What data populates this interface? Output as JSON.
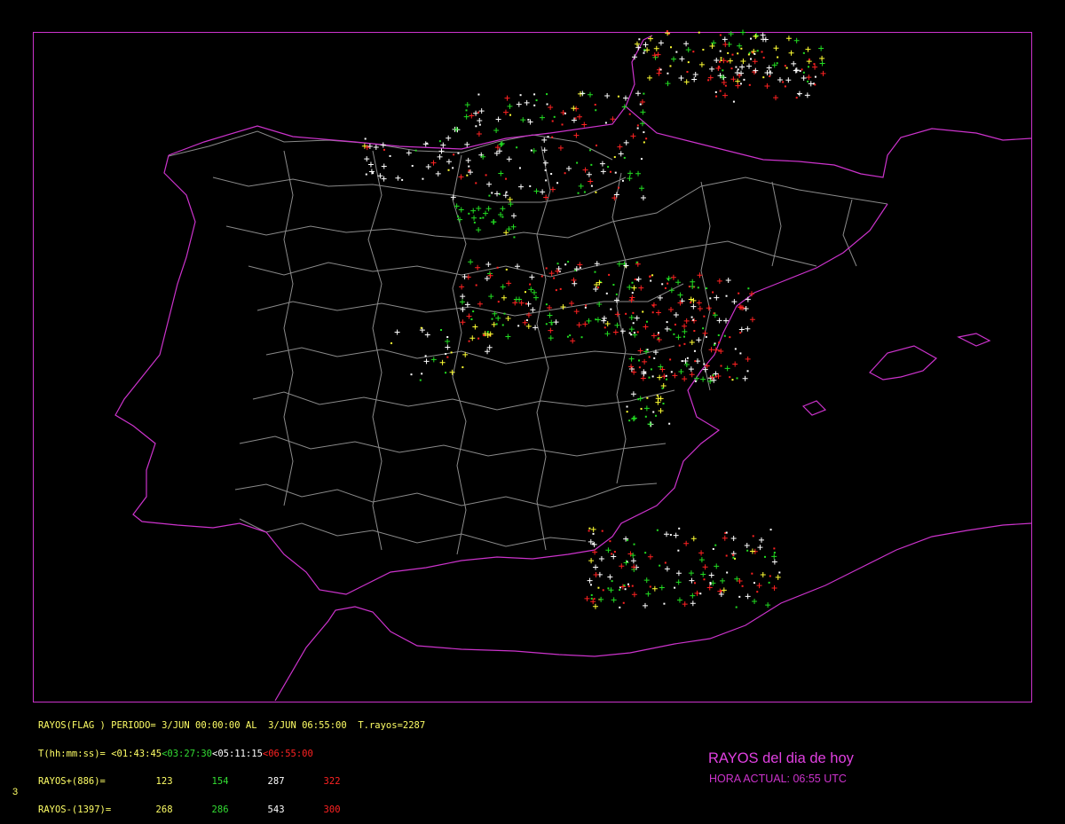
{
  "colors": {
    "frame": "#cc33cc",
    "coast": "#cc33cc",
    "provinces": "#8a8a8a",
    "period1": "#ffff33",
    "period2": "#22dd22",
    "period3": "#ffffff",
    "period4": "#ff2222"
  },
  "stats": {
    "header": "RAYOS(FLAG ) PERIODO= 3/JUN 00:00:00 AL  3/JUN 06:55:00  T.rayos=2287",
    "time_label": "T(hh:mm:ss)= ",
    "times": [
      "<01:43:45",
      "<03:27:30",
      "<05:11:15",
      "<06:55:00"
    ],
    "pos_label": "RAYOS+(886)=  ",
    "pos_values": [
      "123",
      "154",
      "287",
      "322"
    ],
    "neg_label": "RAYOS-(1397)= ",
    "neg_values": [
      "268",
      "286",
      "543",
      "300"
    ]
  },
  "footer": {
    "title": "RAYOS del dia de hoy",
    "current_time": "HORA ACTUAL: 06:55 UTC",
    "page": "3"
  },
  "clusters": [
    {
      "region": "bay-of-biscay-north",
      "type": "mixed",
      "colors": [
        "period1",
        "period2",
        "period3",
        "period4"
      ]
    },
    {
      "region": "cantabria-basque",
      "type": "mixed",
      "colors": [
        "period2",
        "period3",
        "period4"
      ]
    },
    {
      "region": "central-castile",
      "type": "mixed",
      "colors": [
        "period1",
        "period2",
        "period3",
        "period4"
      ]
    },
    {
      "region": "valencia-teruel",
      "type": "mixed",
      "colors": [
        "period1",
        "period2",
        "period3",
        "period4"
      ]
    },
    {
      "region": "andalusia-southeast",
      "type": "mixed",
      "colors": [
        "period1",
        "period2",
        "period3",
        "period4"
      ]
    }
  ]
}
